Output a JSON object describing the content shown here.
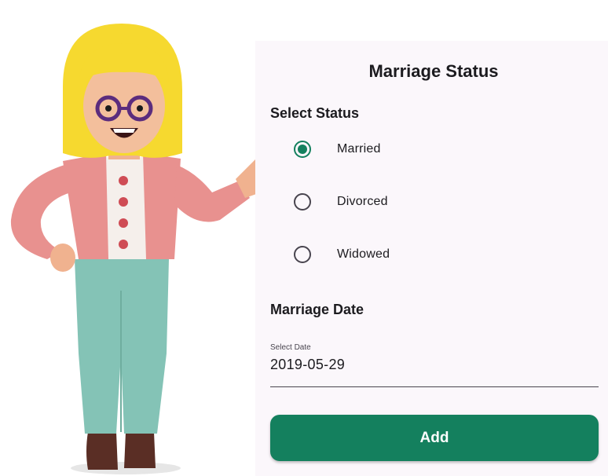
{
  "form": {
    "title": "Marriage Status",
    "status_section_label": "Select Status",
    "status_options": [
      {
        "label": "Married",
        "selected": true
      },
      {
        "label": "Divorced",
        "selected": false
      },
      {
        "label": "Widowed",
        "selected": false
      }
    ],
    "date_section_label": "Marriage Date",
    "date_field": {
      "label": "Select Date",
      "value": "2019-05-29"
    },
    "add_button_label": "Add"
  },
  "colors": {
    "accent": "#14805e",
    "panel_background": "#fbf7fb",
    "text": "#1c1b1f"
  },
  "illustration": {
    "icon": "woman-pointing-illustration"
  }
}
